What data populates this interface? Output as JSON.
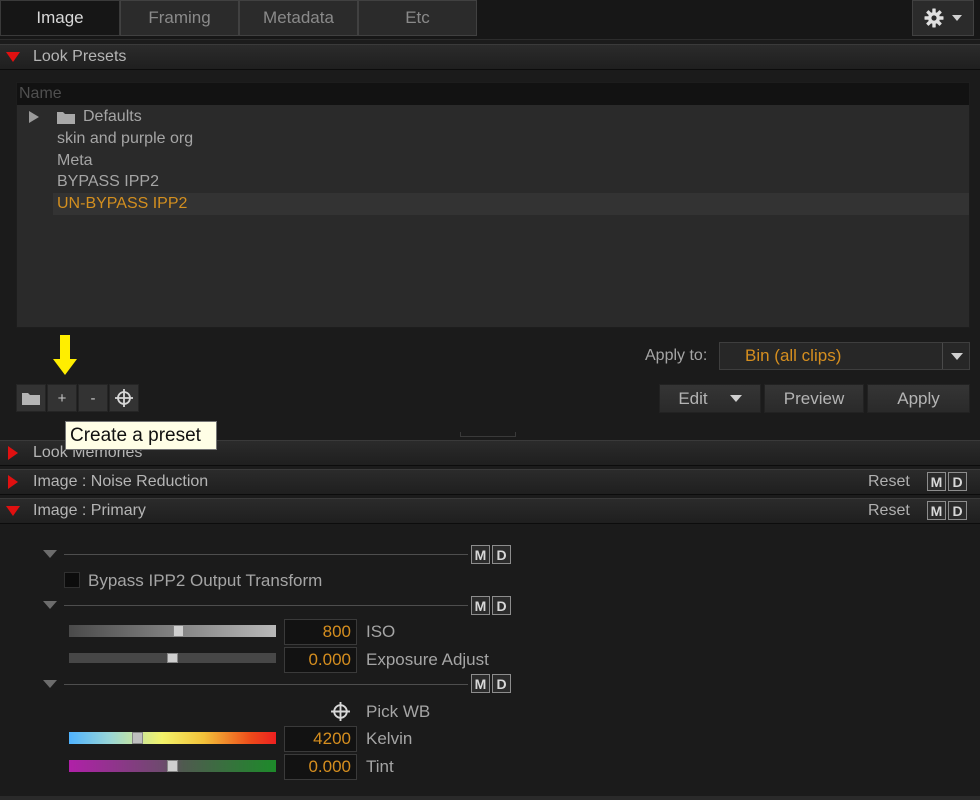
{
  "tabs": [
    "Image",
    "Framing",
    "Metadata",
    "Etc"
  ],
  "active_tab": "Image",
  "sections": {
    "look_presets": "Look Presets",
    "look_memories": "Look Memories",
    "noise_reduction": "Image : Noise Reduction",
    "primary": "Image : Primary"
  },
  "preset_list": {
    "column_header": "Name",
    "items": [
      {
        "label": "Defaults",
        "type": "folder"
      },
      {
        "label": "skin and purple org"
      },
      {
        "label": "Meta"
      },
      {
        "label": "BYPASS IPP2"
      },
      {
        "label": "UN-BYPASS IPP2",
        "selected": true
      }
    ]
  },
  "preset_buttons": {
    "add": "+",
    "remove": "-"
  },
  "apply_to": {
    "label": "Apply to:",
    "value": "Bin (all clips)"
  },
  "actions": {
    "edit": "Edit",
    "preview": "Preview",
    "apply": "Apply"
  },
  "tooltip": "Create a preset",
  "reset_label": "Reset",
  "md": {
    "m": "M",
    "d": "D"
  },
  "primary": {
    "bypass_label": "Bypass IPP2 Output Transform",
    "iso": {
      "value": "800",
      "label": "ISO",
      "slider": 0.53
    },
    "exposure": {
      "value": "0.000",
      "label": "Exposure Adjust",
      "slider": 0.5
    },
    "pick_wb": "Pick WB",
    "kelvin": {
      "value": "4200",
      "label": "Kelvin",
      "slider": 0.32
    },
    "tint": {
      "value": "0.000",
      "label": "Tint",
      "slider": 0.5
    }
  },
  "colors": {
    "accent_orange": "#d58e1f",
    "expand_red": "#e01010",
    "tooltip_bg": "#fffee6",
    "arrow_yellow": "#ffee00"
  }
}
